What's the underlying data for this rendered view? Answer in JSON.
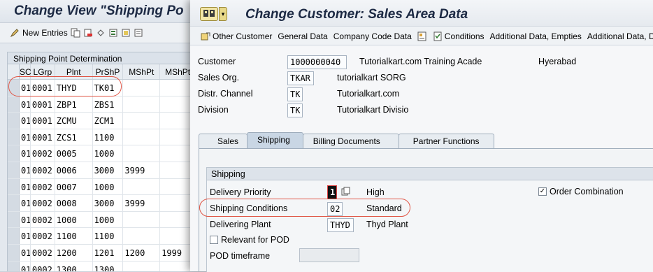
{
  "back": {
    "title": "Change View \"Shipping Po",
    "toolbar_new_entries": "New Entries",
    "panel_title": "Shipping Point Determination",
    "columns": [
      "SC",
      "LGrp",
      "Plnt",
      "PrShP",
      "MShPt",
      "MShPt"
    ],
    "rows": [
      [
        "01",
        "0001",
        "THYD",
        "TK01",
        "",
        ""
      ],
      [
        "01",
        "0001",
        "ZBP1",
        "ZBS1",
        "",
        ""
      ],
      [
        "01",
        "0001",
        "ZCMU",
        "ZCM1",
        "",
        ""
      ],
      [
        "01",
        "0001",
        "ZCS1",
        "1100",
        "",
        ""
      ],
      [
        "01",
        "0002",
        "0005",
        "1000",
        "",
        ""
      ],
      [
        "01",
        "0002",
        "0006",
        "3000",
        "3999",
        ""
      ],
      [
        "01",
        "0002",
        "0007",
        "1000",
        "",
        ""
      ],
      [
        "01",
        "0002",
        "0008",
        "3000",
        "3999",
        ""
      ],
      [
        "01",
        "0002",
        "1000",
        "1000",
        "",
        ""
      ],
      [
        "01",
        "0002",
        "1100",
        "1100",
        "",
        ""
      ],
      [
        "01",
        "0002",
        "1200",
        "1201",
        "1200",
        "1999"
      ],
      [
        "01",
        "0002",
        "1300",
        "1300",
        "",
        ""
      ]
    ]
  },
  "front": {
    "title": "Change Customer: Sales Area Data",
    "toolbar": {
      "other_customer": "Other Customer",
      "general_data": "General Data",
      "company_code_data": "Company Code Data",
      "sales_area_conditions": "Conditions",
      "additional_data_empties": "Additional Data, Empties",
      "additional_data_dsd": "Additional Data, DSD"
    },
    "header_fields": {
      "customer_label": "Customer",
      "customer_value": "1000000040",
      "customer_name": "Tutorialkart.com Training Acade",
      "customer_city": "Hyerabad",
      "sales_org_label": "Sales Org.",
      "sales_org_value": "TKAR",
      "sales_org_desc": "tutorialkart SORG",
      "distr_channel_label": "Distr. Channel",
      "distr_channel_value": "TK",
      "distr_channel_desc": "Tutorialkart.com",
      "division_label": "Division",
      "division_value": "TK",
      "division_desc": "Tutorialkart Divisio"
    },
    "tabs": [
      "Sales",
      "Shipping",
      "Billing Documents",
      "Partner Functions"
    ],
    "shipping": {
      "group_title": "Shipping",
      "delivery_priority_label": "Delivery Priority",
      "delivery_priority_value": "1",
      "delivery_priority_desc": "High",
      "order_combination_label": "Order Combination",
      "order_combination_checked": true,
      "shipping_conditions_label": "Shipping Conditions",
      "shipping_conditions_value": "02",
      "shipping_conditions_desc": "Standard",
      "delivering_plant_label": "Delivering Plant",
      "delivering_plant_value": "THYD",
      "delivering_plant_desc": "Thyd Plant",
      "relevant_for_pod_label": "Relevant for POD",
      "relevant_for_pod_checked": false,
      "pod_timeframe_label": "POD timeframe",
      "pod_timeframe_value": ""
    }
  },
  "colors": {
    "highlight_oval": "#e05545",
    "title_text": "#1d2a44"
  }
}
